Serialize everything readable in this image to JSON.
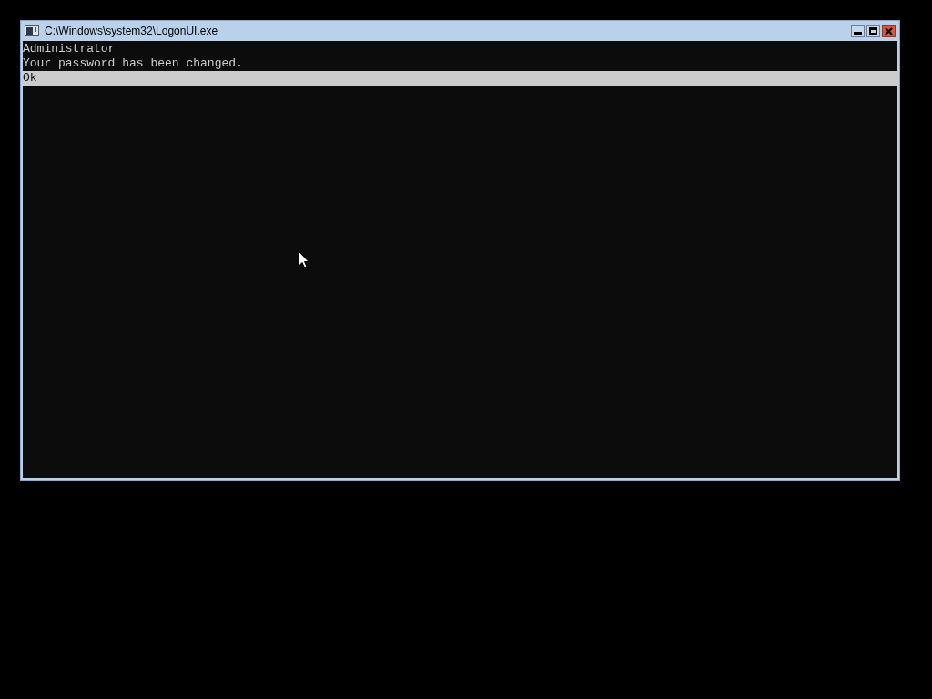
{
  "window": {
    "title": "C:\\Windows\\system32\\LogonUI.exe"
  },
  "console": {
    "lines": [
      "Administrator",
      "Your password has been changed."
    ],
    "options": [
      {
        "label": "Ok",
        "selected": true
      }
    ]
  }
}
